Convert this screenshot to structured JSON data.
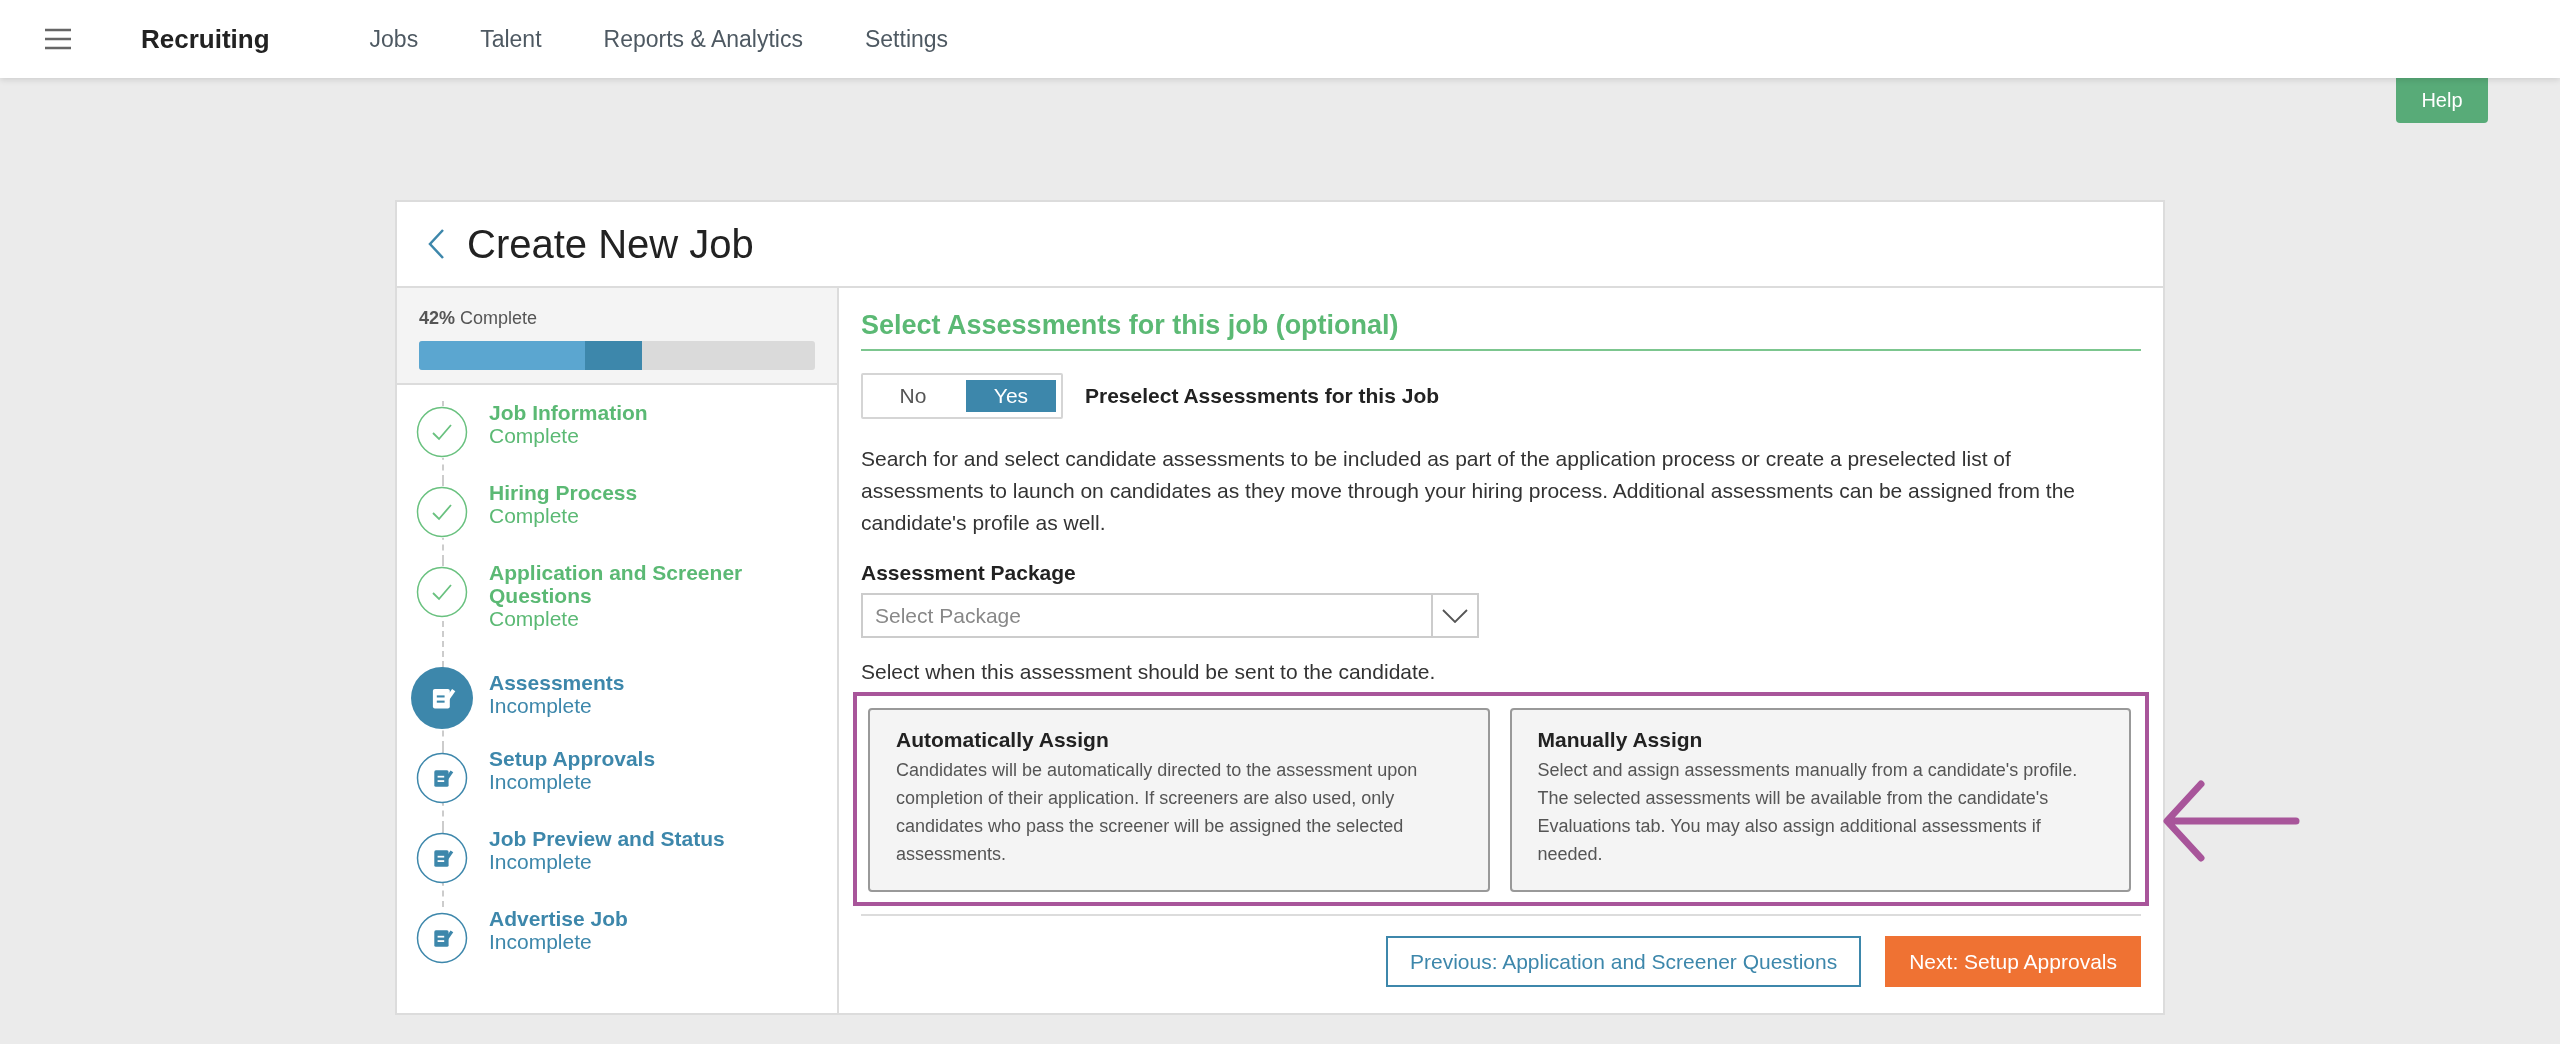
{
  "nav": {
    "app_title": "Recruiting",
    "links": [
      {
        "label": "Jobs"
      },
      {
        "label": "Talent"
      },
      {
        "label": "Reports & Analytics"
      },
      {
        "label": "Settings"
      }
    ]
  },
  "help_button": "Help",
  "page": {
    "title": "Create New Job"
  },
  "progress": {
    "percent": "42%",
    "label": "Complete",
    "level": 0.42
  },
  "steps": [
    {
      "title": "Job Information",
      "status": "Complete",
      "kind": "complete"
    },
    {
      "title": "Hiring Process",
      "status": "Complete",
      "kind": "complete"
    },
    {
      "title": "Application and Screener Questions",
      "status": "Complete",
      "kind": "complete"
    },
    {
      "title": "Assessments",
      "status": "Incomplete",
      "kind": "current"
    },
    {
      "title": "Setup Approvals",
      "status": "Incomplete",
      "kind": "incomplete"
    },
    {
      "title": "Job Preview and Status",
      "status": "Incomplete",
      "kind": "incomplete"
    },
    {
      "title": "Advertise Job",
      "status": "Incomplete",
      "kind": "incomplete"
    }
  ],
  "section": {
    "heading": "Select Assessments for this job (optional)",
    "toggle": {
      "options": [
        {
          "label": "No",
          "selected": false
        },
        {
          "label": "Yes",
          "selected": true
        }
      ],
      "label": "Preselect Assessments for this Job"
    },
    "description": "Search for and select candidate assessments to be included as part of the application process or create a preselected list of assessments to launch on candidates as they move through your hiring process. Additional assessments can be assigned from the candidate's profile as well.",
    "package": {
      "label": "Assessment Package",
      "placeholder": "Select Package"
    },
    "timing_prompt": "Select when this assessment should be sent to the candidate.",
    "assign_options": {
      "highlighted": true,
      "options": [
        {
          "title": "Automatically Assign",
          "text": "Candidates will be automatically directed to the assessment upon completion of their application. If screeners are also used, only candidates who pass the screener will be assigned the selected assessments.",
          "selected": false
        },
        {
          "title": "Manually Assign",
          "text": "Select and assign assessments manually from a candidate's profile. The selected assessments will be available from the candidate's Evaluations tab. You may also assign additional assessments if needed.",
          "selected": false
        }
      ]
    }
  },
  "footer": {
    "previous": "Previous: Application and Screener Questions",
    "next": "Next: Setup Approvals"
  }
}
